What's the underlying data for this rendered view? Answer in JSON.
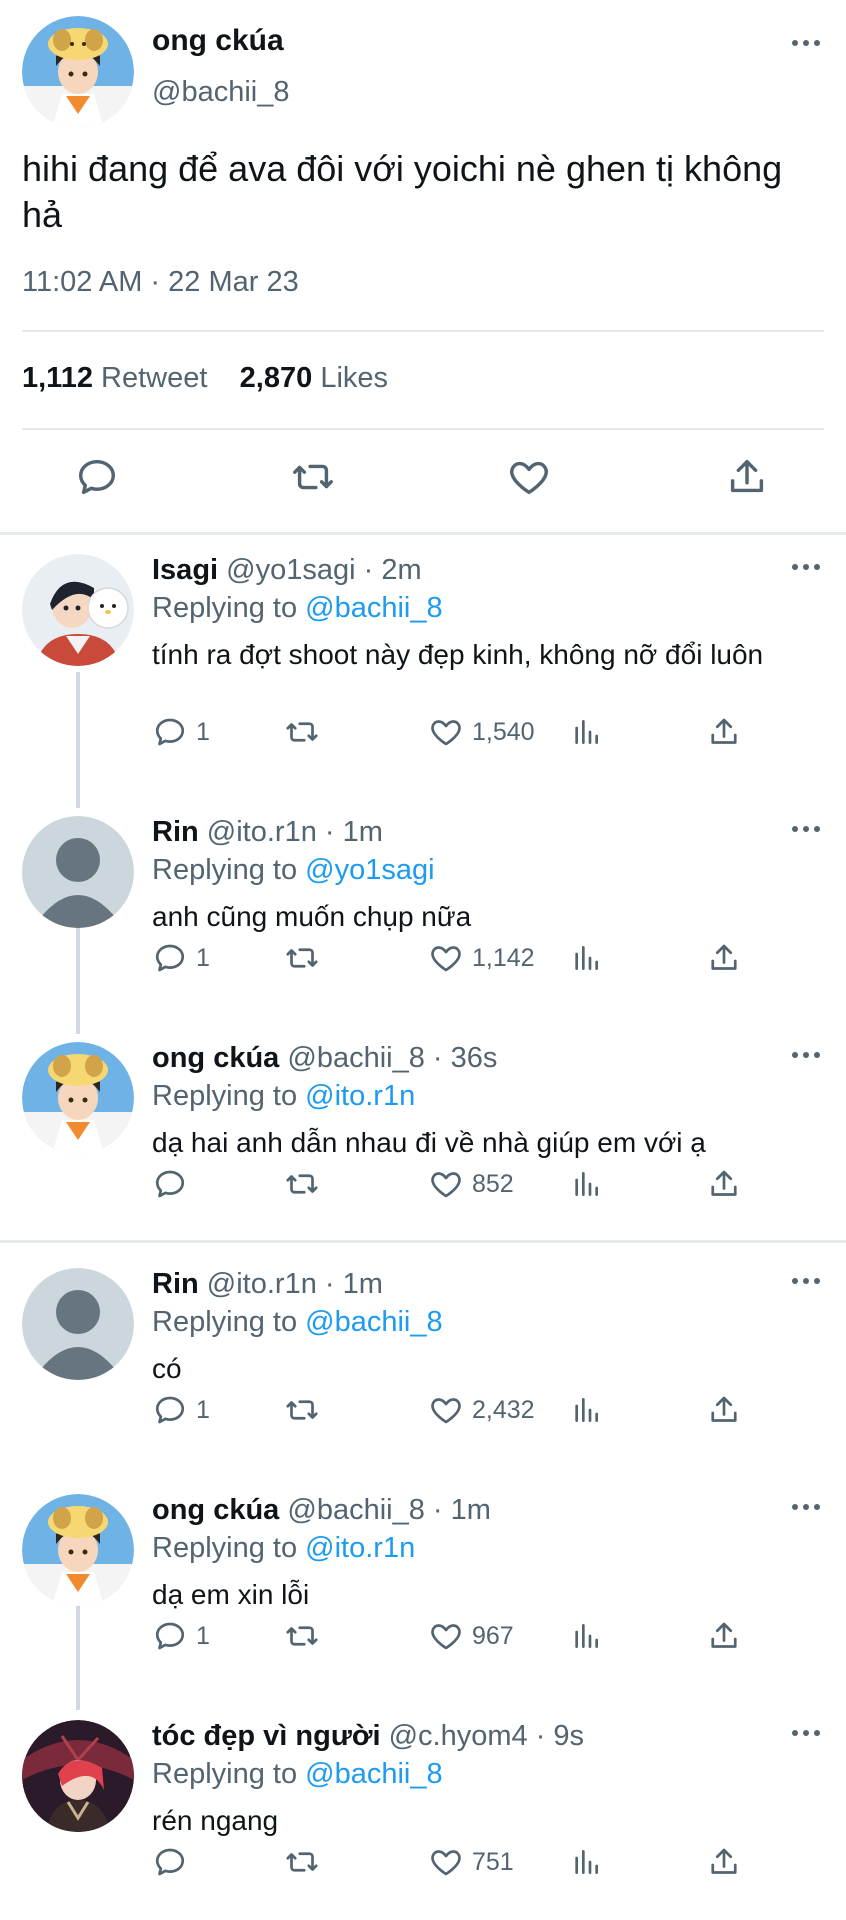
{
  "main_tweet": {
    "name": "ong ckúa",
    "handle": "@bachii_8",
    "text": "hihi đang để ava đôi với yoichi nè ghen tị không hả",
    "time": "11:02 AM · 22 Mar 23",
    "retweet_count": "1,112",
    "retweet_label": "Retweet",
    "likes_count": "2,870",
    "likes_label": "Likes",
    "actions": [
      "reply-icon",
      "retweet-icon",
      "like-icon",
      "share-icon"
    ]
  },
  "replies": [
    {
      "name": "Isagi",
      "handle": "@yo1sagi",
      "time": "2m",
      "replying_label": "Replying to",
      "replying_to": "@bachii_8",
      "text": "tính ra đợt shoot này đẹp kinh, không nỡ đổi luôn",
      "reply_count": "1",
      "like_count": "1,540",
      "avatar": "isagi-avatar"
    },
    {
      "name": "Rin",
      "handle": "@ito.r1n",
      "time": "1m",
      "replying_label": "Replying to",
      "replying_to": "@yo1sagi",
      "text": "anh cũng muốn chụp nữa",
      "reply_count": "1",
      "like_count": "1,142",
      "avatar": "default-avatar"
    },
    {
      "name": "ong ckúa",
      "handle": "@bachii_8",
      "time": "36s",
      "replying_label": "Replying to",
      "replying_to": "@ito.r1n",
      "text": "dạ hai anh dẫn nhau đi về nhà giúp em với ạ",
      "reply_count": "",
      "like_count": "852",
      "avatar": "bachii-avatar"
    },
    {
      "name": "Rin",
      "handle": "@ito.r1n",
      "time": "1m",
      "replying_label": "Replying to",
      "replying_to": "@bachii_8",
      "text": "có",
      "reply_count": "1",
      "like_count": "2,432",
      "avatar": "default-avatar"
    },
    {
      "name": "ong ckúa",
      "handle": "@bachii_8",
      "time": "1m",
      "replying_label": "Replying to",
      "replying_to": "@ito.r1n",
      "text": "dạ em xin lỗi",
      "reply_count": "1",
      "like_count": "967",
      "avatar": "bachii-avatar"
    },
    {
      "name": "tóc đẹp vì người",
      "handle": "@c.hyom4",
      "time": "9s",
      "replying_label": "Replying to",
      "replying_to": "@bachii_8",
      "text": "rén ngang",
      "reply_count": "",
      "like_count": "751",
      "avatar": "hyoma-avatar"
    }
  ],
  "colors": {
    "text": "#0f1419",
    "secondary": "#536471",
    "link": "#1d9bf0",
    "divider": "#e6e9ea"
  }
}
